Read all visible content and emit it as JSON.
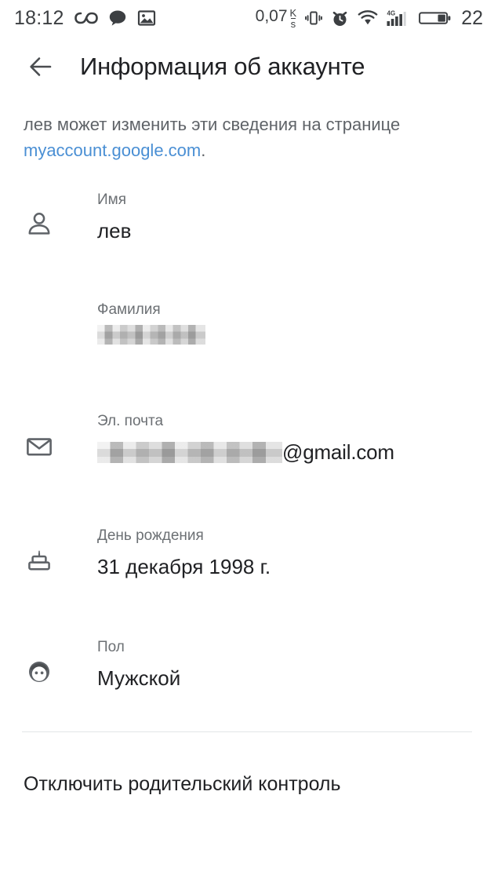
{
  "statusbar": {
    "time": "18:12",
    "network_speed": "0,07",
    "speed_unit_num": "K",
    "speed_unit_den": "s",
    "battery_percent": "22",
    "icons": {
      "infinity": "infinity-icon",
      "chat": "chat-bubble-icon",
      "gallery": "image-icon",
      "vibrate": "vibrate-icon",
      "alarm": "alarm-clock-icon",
      "wifi": "wifi-icon",
      "signal": "signal-bars-icon",
      "network_type": "4G",
      "battery": "battery-icon"
    }
  },
  "header": {
    "back_label": "back-arrow",
    "title": "Информация об аккаунте"
  },
  "description": {
    "text_before": "лев может изменить эти сведения на странице ",
    "link": "myaccount.google.com",
    "text_after": "."
  },
  "fields": [
    {
      "icon": "person-icon",
      "label": "Имя",
      "value": "лев",
      "redacted": false
    },
    {
      "icon": "none",
      "label": "Фамилия",
      "value": "",
      "redacted": true
    },
    {
      "icon": "email-icon",
      "label": "Эл. почта",
      "value": "@gmail.com",
      "redacted": true
    },
    {
      "icon": "cake-icon",
      "label": "День рождения",
      "value": "31 декабря 1998 г.",
      "redacted": false
    },
    {
      "icon": "face-icon",
      "label": "Пол",
      "value": "Мужской",
      "redacted": false
    }
  ],
  "action": {
    "label": "Отключить родительский контроль"
  },
  "colors": {
    "link": "#4a8fd4",
    "label": "#6c7074",
    "value": "#202124",
    "icon": "#5f6368",
    "divider": "#e3e5e7",
    "background": "#ffffff"
  }
}
